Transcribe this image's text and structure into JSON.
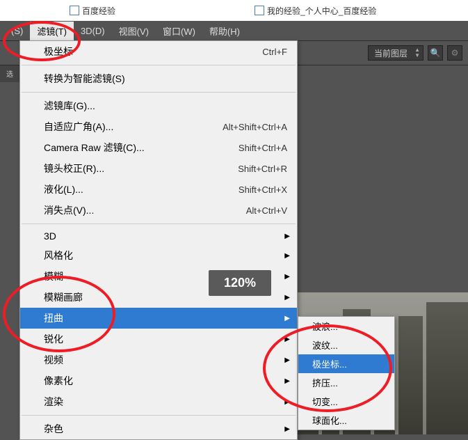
{
  "tabs": [
    {
      "label": "百度经验"
    },
    {
      "label": "我的经验_个人中心_百度经验"
    }
  ],
  "menubar": {
    "items": [
      {
        "label": "(S)"
      },
      {
        "label": "滤镜(T)",
        "active": true
      },
      {
        "label": "3D(D)"
      },
      {
        "label": "视图(V)"
      },
      {
        "label": "窗口(W)"
      },
      {
        "label": "帮助(H)"
      }
    ]
  },
  "toolbar": {
    "layer_select": "当前图层"
  },
  "filter_menu": {
    "last_filter": {
      "label": "极坐标",
      "shortcut": "Ctrl+F"
    },
    "convert_smart": {
      "label": "转换为智能滤镜(S)"
    },
    "gallery": {
      "label": "滤镜库(G)..."
    },
    "adaptive": {
      "label": "自适应广角(A)...",
      "shortcut": "Alt+Shift+Ctrl+A"
    },
    "cameraraw": {
      "label": "Camera Raw 滤镜(C)...",
      "shortcut": "Shift+Ctrl+A"
    },
    "lens": {
      "label": "镜头校正(R)...",
      "shortcut": "Shift+Ctrl+R"
    },
    "liquify": {
      "label": "液化(L)...",
      "shortcut": "Shift+Ctrl+X"
    },
    "vanishing": {
      "label": "消失点(V)...",
      "shortcut": "Alt+Ctrl+V"
    },
    "groups": {
      "three_d": "3D",
      "stylize": "风格化",
      "blur": "模糊",
      "blur_gallery": "模糊画廊",
      "distort": "扭曲",
      "sharpen": "锐化",
      "video": "视频",
      "pixelate": "像素化",
      "render": "渲染",
      "noise": "杂色"
    }
  },
  "distort_submenu": {
    "items": {
      "wave": "波浪...",
      "ripple": "波纹...",
      "polar": "极坐标...",
      "pinch": "挤压...",
      "shear": "切变...",
      "spherize": "球面化..."
    }
  },
  "overlay": {
    "zoom": "120%"
  }
}
